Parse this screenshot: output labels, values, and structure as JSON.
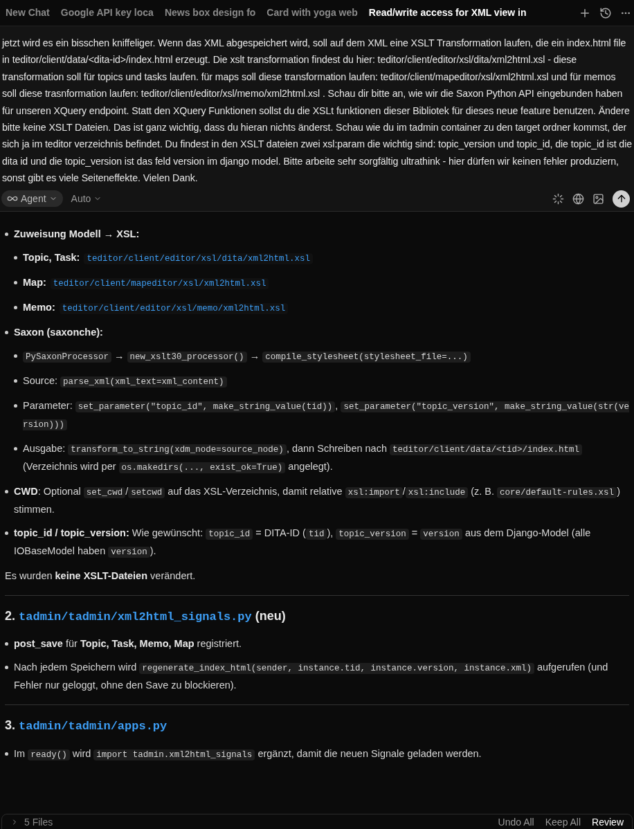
{
  "tabs": [
    {
      "label": "New Chat",
      "selected": false
    },
    {
      "label": "Google API key loca",
      "selected": false
    },
    {
      "label": "News box design fo",
      "selected": false
    },
    {
      "label": "Card with yoga web",
      "selected": false
    },
    {
      "label": "Read/write access for XML view in",
      "selected": true
    }
  ],
  "composer": {
    "prompt": "jetzt wird es ein bisschen kniffeliger. Wenn das XML abgespeichert wird, soll auf dem XML eine XSLT Transformation laufen, die ein index.html file in teditor/client/data/<dita-id>/index.html erzeugt. Die xslt transformation findest du hier: teditor/client/editor/xsl/dita/xml2html.xsl - diese transformation soll für topics und tasks laufen. für maps soll diese transformation laufen: teditor/client/mapeditor/xsl/xml2html.xsl  und für memos soll diese trasnformation laufen: teditor/client/editor/xsl/memo/xml2html.xsl . Schau dir bitte an, wie wir die Saxon Python API eingebunden haben für unseren XQuery endpoint. Statt den XQuery Funktionen sollst du die XSLt funktionen dieser Bibliotek  für dieses neue feature benutzen. Ändere bitte keine XSLT Dateien. Das ist ganz wichtig, dass du hieran nichts änderst. Schau wie du im tadmin container zu den target ordner kommst, der sich ja im teditor verzeichnis befindet. Du findest in den XSLT dateien zwei xsl:param die wichtig sind: topic_version und topic_id, die topic_id ist die dita id und die topic_version ist das feld version im django model. Bitte arbeite sehr sorgfältig ultrathink - hier dürfen wir keinen fehler produziern, sonst gibt es viele Seiteneffekte. Vielen Dank.",
    "mode": "Agent",
    "model": "Auto",
    "busy": true
  },
  "intro": {
    "items": [
      {
        "segments": [
          {
            "kind": "bold",
            "text": "Zuweisung Modell → XSL:"
          }
        ],
        "children": [
          {
            "segments": [
              {
                "kind": "bold",
                "text": "Topic, Task:"
              },
              {
                "kind": "path",
                "text": "teditor/client/editor/xsl/dita/xml2html.xsl"
              }
            ]
          },
          {
            "segments": [
              {
                "kind": "bold",
                "text": "Map:"
              },
              {
                "kind": "path",
                "text": "teditor/client/mapeditor/xsl/xml2html.xsl"
              }
            ]
          },
          {
            "segments": [
              {
                "kind": "bold",
                "text": "Memo:"
              },
              {
                "kind": "path",
                "text": "teditor/client/editor/xsl/memo/xml2html.xsl"
              }
            ]
          }
        ]
      },
      {
        "segments": [
          {
            "kind": "bold",
            "text": "Saxon (saxonche):"
          }
        ],
        "children": [
          {
            "segments": [
              {
                "kind": "code",
                "text": "PySaxonProcessor"
              },
              {
                "kind": "text",
                "text": " → "
              },
              {
                "kind": "code",
                "text": "new_xslt30_processor()"
              },
              {
                "kind": "text",
                "text": " → "
              },
              {
                "kind": "code",
                "text": "compile_stylesheet(stylesheet_file=...)"
              }
            ]
          },
          {
            "segments": [
              {
                "kind": "text",
                "text": "Source: "
              },
              {
                "kind": "code",
                "text": "parse_xml(xml_text=xml_content)"
              }
            ]
          },
          {
            "segments": [
              {
                "kind": "text",
                "text": "Parameter: "
              },
              {
                "kind": "code",
                "text": "set_parameter(\"topic_id\", make_string_value(tid))"
              },
              {
                "kind": "text",
                "text": ", "
              },
              {
                "kind": "code",
                "text": "set_parameter(\"topic_version\", make_string_value(str(version)))"
              }
            ]
          },
          {
            "segments": [
              {
                "kind": "text",
                "text": "Ausgabe: "
              },
              {
                "kind": "code",
                "text": "transform_to_string(xdm_node=source_node)"
              },
              {
                "kind": "text",
                "text": ", dann Schreiben nach "
              },
              {
                "kind": "code",
                "text": "teditor/client/data/<tid>/index.html"
              },
              {
                "kind": "text",
                "text": " (Verzeichnis wird per "
              },
              {
                "kind": "code",
                "text": "os.makedirs(..., exist_ok=True)"
              },
              {
                "kind": "text",
                "text": " angelegt)."
              }
            ]
          }
        ]
      },
      {
        "segments": [
          {
            "kind": "bold",
            "text": "CWD"
          },
          {
            "kind": "text",
            "text": ": Optional "
          },
          {
            "kind": "code",
            "text": "set_cwd"
          },
          {
            "kind": "text",
            "text": "/"
          },
          {
            "kind": "code",
            "text": "setcwd"
          },
          {
            "kind": "text",
            "text": " auf das XSL-Verzeichnis, damit relative "
          },
          {
            "kind": "code",
            "text": "xsl:import"
          },
          {
            "kind": "text",
            "text": "/"
          },
          {
            "kind": "code",
            "text": "xsl:include"
          },
          {
            "kind": "text",
            "text": " (z. B. "
          },
          {
            "kind": "code",
            "text": "core/default-rules.xsl"
          },
          {
            "kind": "text",
            "text": ") stimmen."
          }
        ]
      },
      {
        "segments": [
          {
            "kind": "bold",
            "text": "topic_id / topic_version:"
          },
          {
            "kind": "text",
            "text": " Wie gewünscht: "
          },
          {
            "kind": "code",
            "text": "topic_id"
          },
          {
            "kind": "text",
            "text": " = DITA-ID ("
          },
          {
            "kind": "code",
            "text": "tid"
          },
          {
            "kind": "text",
            "text": "), "
          },
          {
            "kind": "code",
            "text": "topic_version"
          },
          {
            "kind": "text",
            "text": " = "
          },
          {
            "kind": "code",
            "text": "version"
          },
          {
            "kind": "text",
            "text": " aus dem Django-Model (alle IOBaseModel haben "
          },
          {
            "kind": "code",
            "text": "version"
          },
          {
            "kind": "text",
            "text": ")."
          }
        ]
      }
    ],
    "paragraph": [
      {
        "kind": "text",
        "text": "Es wurden "
      },
      {
        "kind": "bold",
        "text": "keine XSLT-Dateien"
      },
      {
        "kind": "text",
        "text": " verändert."
      }
    ]
  },
  "sections": [
    {
      "number": "2.",
      "path": "tadmin/tadmin/xml2html_signals.py",
      "suffix": "(neu)",
      "items": [
        {
          "segments": [
            {
              "kind": "bold",
              "text": "post_save"
            },
            {
              "kind": "text",
              "text": " für "
            },
            {
              "kind": "bold",
              "text": "Topic, Task, Memo, Map"
            },
            {
              "kind": "text",
              "text": " registriert."
            }
          ]
        },
        {
          "segments": [
            {
              "kind": "text",
              "text": "Nach jedem Speichern wird "
            },
            {
              "kind": "code",
              "text": "regenerate_index_html(sender, instance.tid, instance.version, instance.xml)"
            },
            {
              "kind": "text",
              "text": " aufgerufen (und Fehler nur geloggt, ohne den Save zu blockieren)."
            }
          ]
        }
      ]
    },
    {
      "number": "3.",
      "path": "tadmin/tadmin/apps.py",
      "items": [
        {
          "segments": [
            {
              "kind": "text",
              "text": "Im "
            },
            {
              "kind": "code",
              "text": "ready()"
            },
            {
              "kind": "text",
              "text": " wird "
            },
            {
              "kind": "code",
              "text": "import tadmin.xml2html_signals"
            },
            {
              "kind": "text",
              "text": " ergänzt, damit die neuen Signale geladen werden."
            }
          ]
        }
      ]
    }
  ],
  "review_bar": {
    "files": "5 Files",
    "expanded": false,
    "actions": [
      "Undo All",
      "Keep All",
      "Review"
    ]
  }
}
